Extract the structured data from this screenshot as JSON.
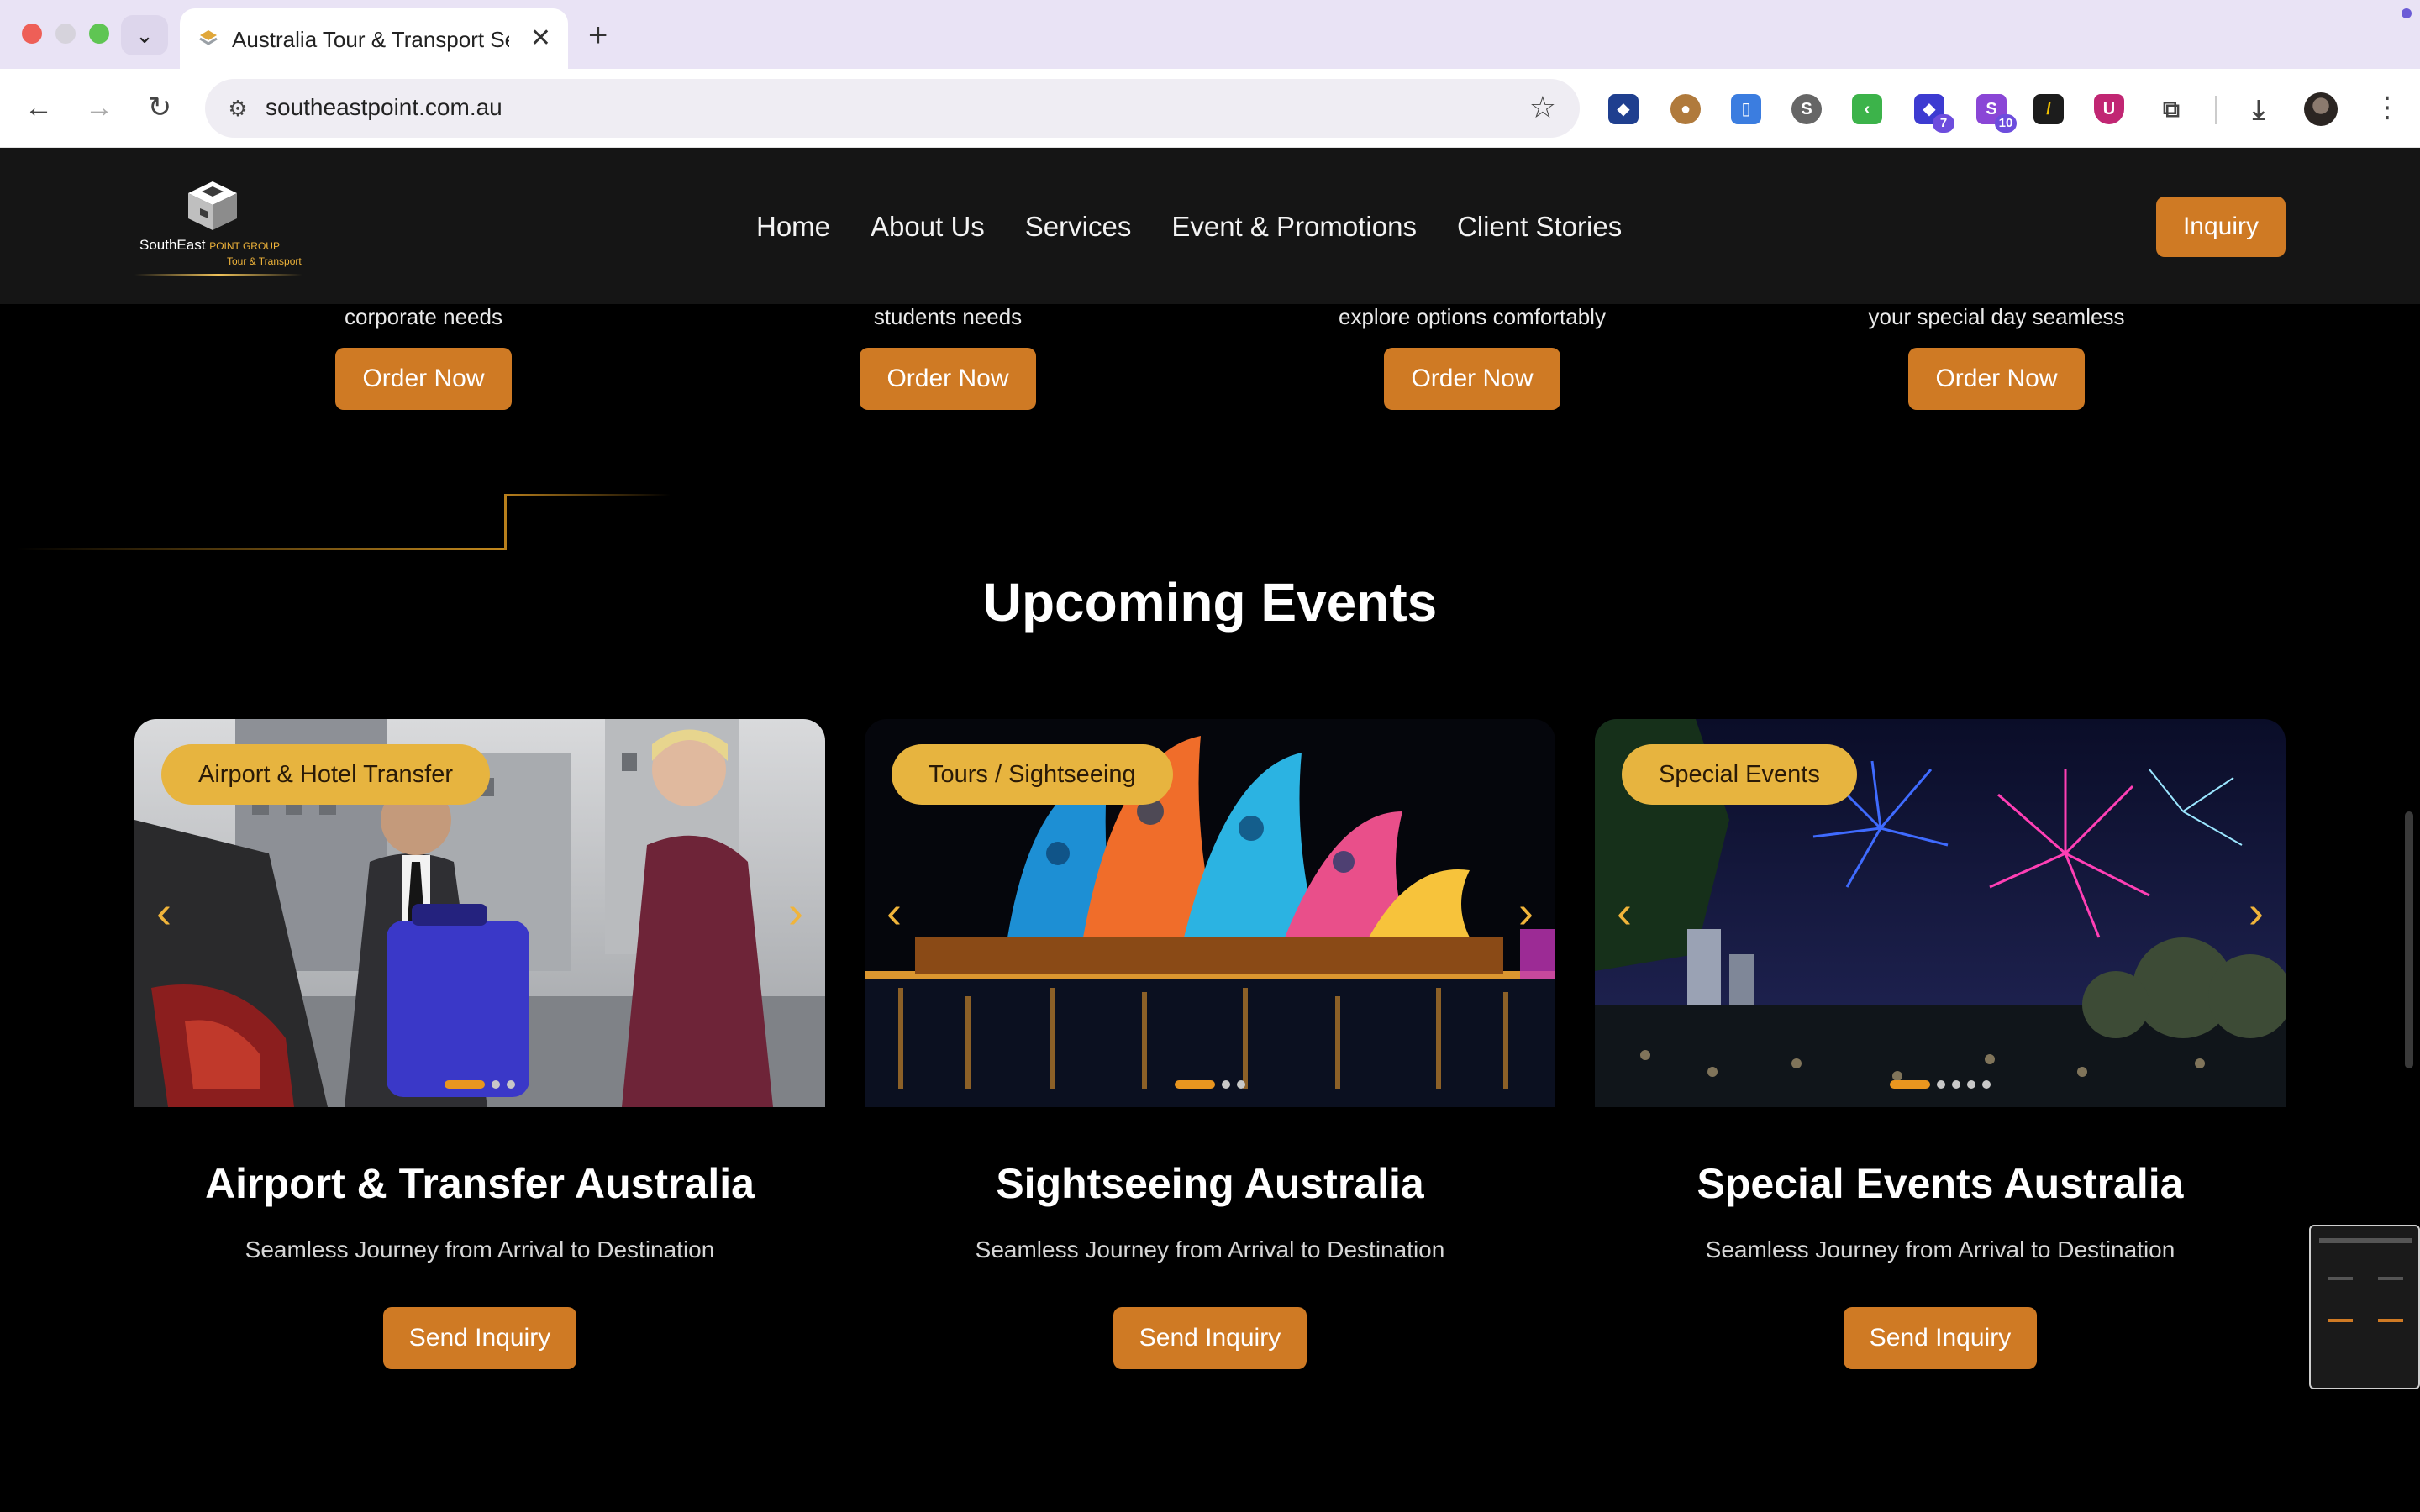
{
  "browser": {
    "tab_title": "Australia Tour & Transport Se",
    "url": "southeastpoint.com.au",
    "extensions": [
      {
        "icon": "puzzle-extension-icon",
        "badge": ""
      },
      {
        "icon": "cookie-icon",
        "badge": ""
      },
      {
        "icon": "clipboard-icon",
        "badge": ""
      },
      {
        "icon": "s-circle-icon",
        "badge": ""
      },
      {
        "icon": "green-arrow-icon",
        "badge": ""
      },
      {
        "icon": "purple-diamond-icon",
        "badge": "7"
      },
      {
        "icon": "s-purple-icon",
        "badge": "10"
      },
      {
        "icon": "slash-yellow-icon",
        "badge": ""
      },
      {
        "icon": "shield-u-icon",
        "badge": ""
      },
      {
        "icon": "extensions-icon",
        "badge": ""
      }
    ]
  },
  "header": {
    "logo": {
      "name": "SouthEast",
      "group": "POINT GROUP",
      "sub": "Tour & Transport"
    },
    "nav": [
      "Home",
      "About Us",
      "Services",
      "Event & Promotions",
      "Client Stories"
    ],
    "inquiry": "Inquiry"
  },
  "services": [
    {
      "desc": "corporate needs",
      "button": "Order Now"
    },
    {
      "desc": "students needs",
      "button": "Order Now"
    },
    {
      "desc": "explore options comfortably",
      "button": "Order Now"
    },
    {
      "desc": "your special day seamless",
      "button": "Order Now"
    }
  ],
  "events": {
    "title": "Upcoming Events",
    "cards": [
      {
        "tag": "Airport & Hotel Transfer",
        "title": "Airport & Transfer Australia",
        "desc": "Seamless Journey from Arrival to Destination",
        "button": "Send Inquiry",
        "slides": 3,
        "active_slide": 1
      },
      {
        "tag": "Tours / Sightseeing",
        "title": "Sightseeing Australia",
        "desc": "Seamless Journey from Arrival to Destination",
        "button": "Send Inquiry",
        "slides": 3,
        "active_slide": 1
      },
      {
        "tag": "Special Events",
        "title": "Special Events Australia",
        "desc": "Seamless Journey from Arrival to Destination",
        "button": "Send Inquiry",
        "slides": 5,
        "active_slide": 1
      }
    ]
  },
  "colors": {
    "accent": "#cf7a24",
    "tag": "#e7b43f",
    "gold": "#f0b43a",
    "background": "#000000"
  }
}
